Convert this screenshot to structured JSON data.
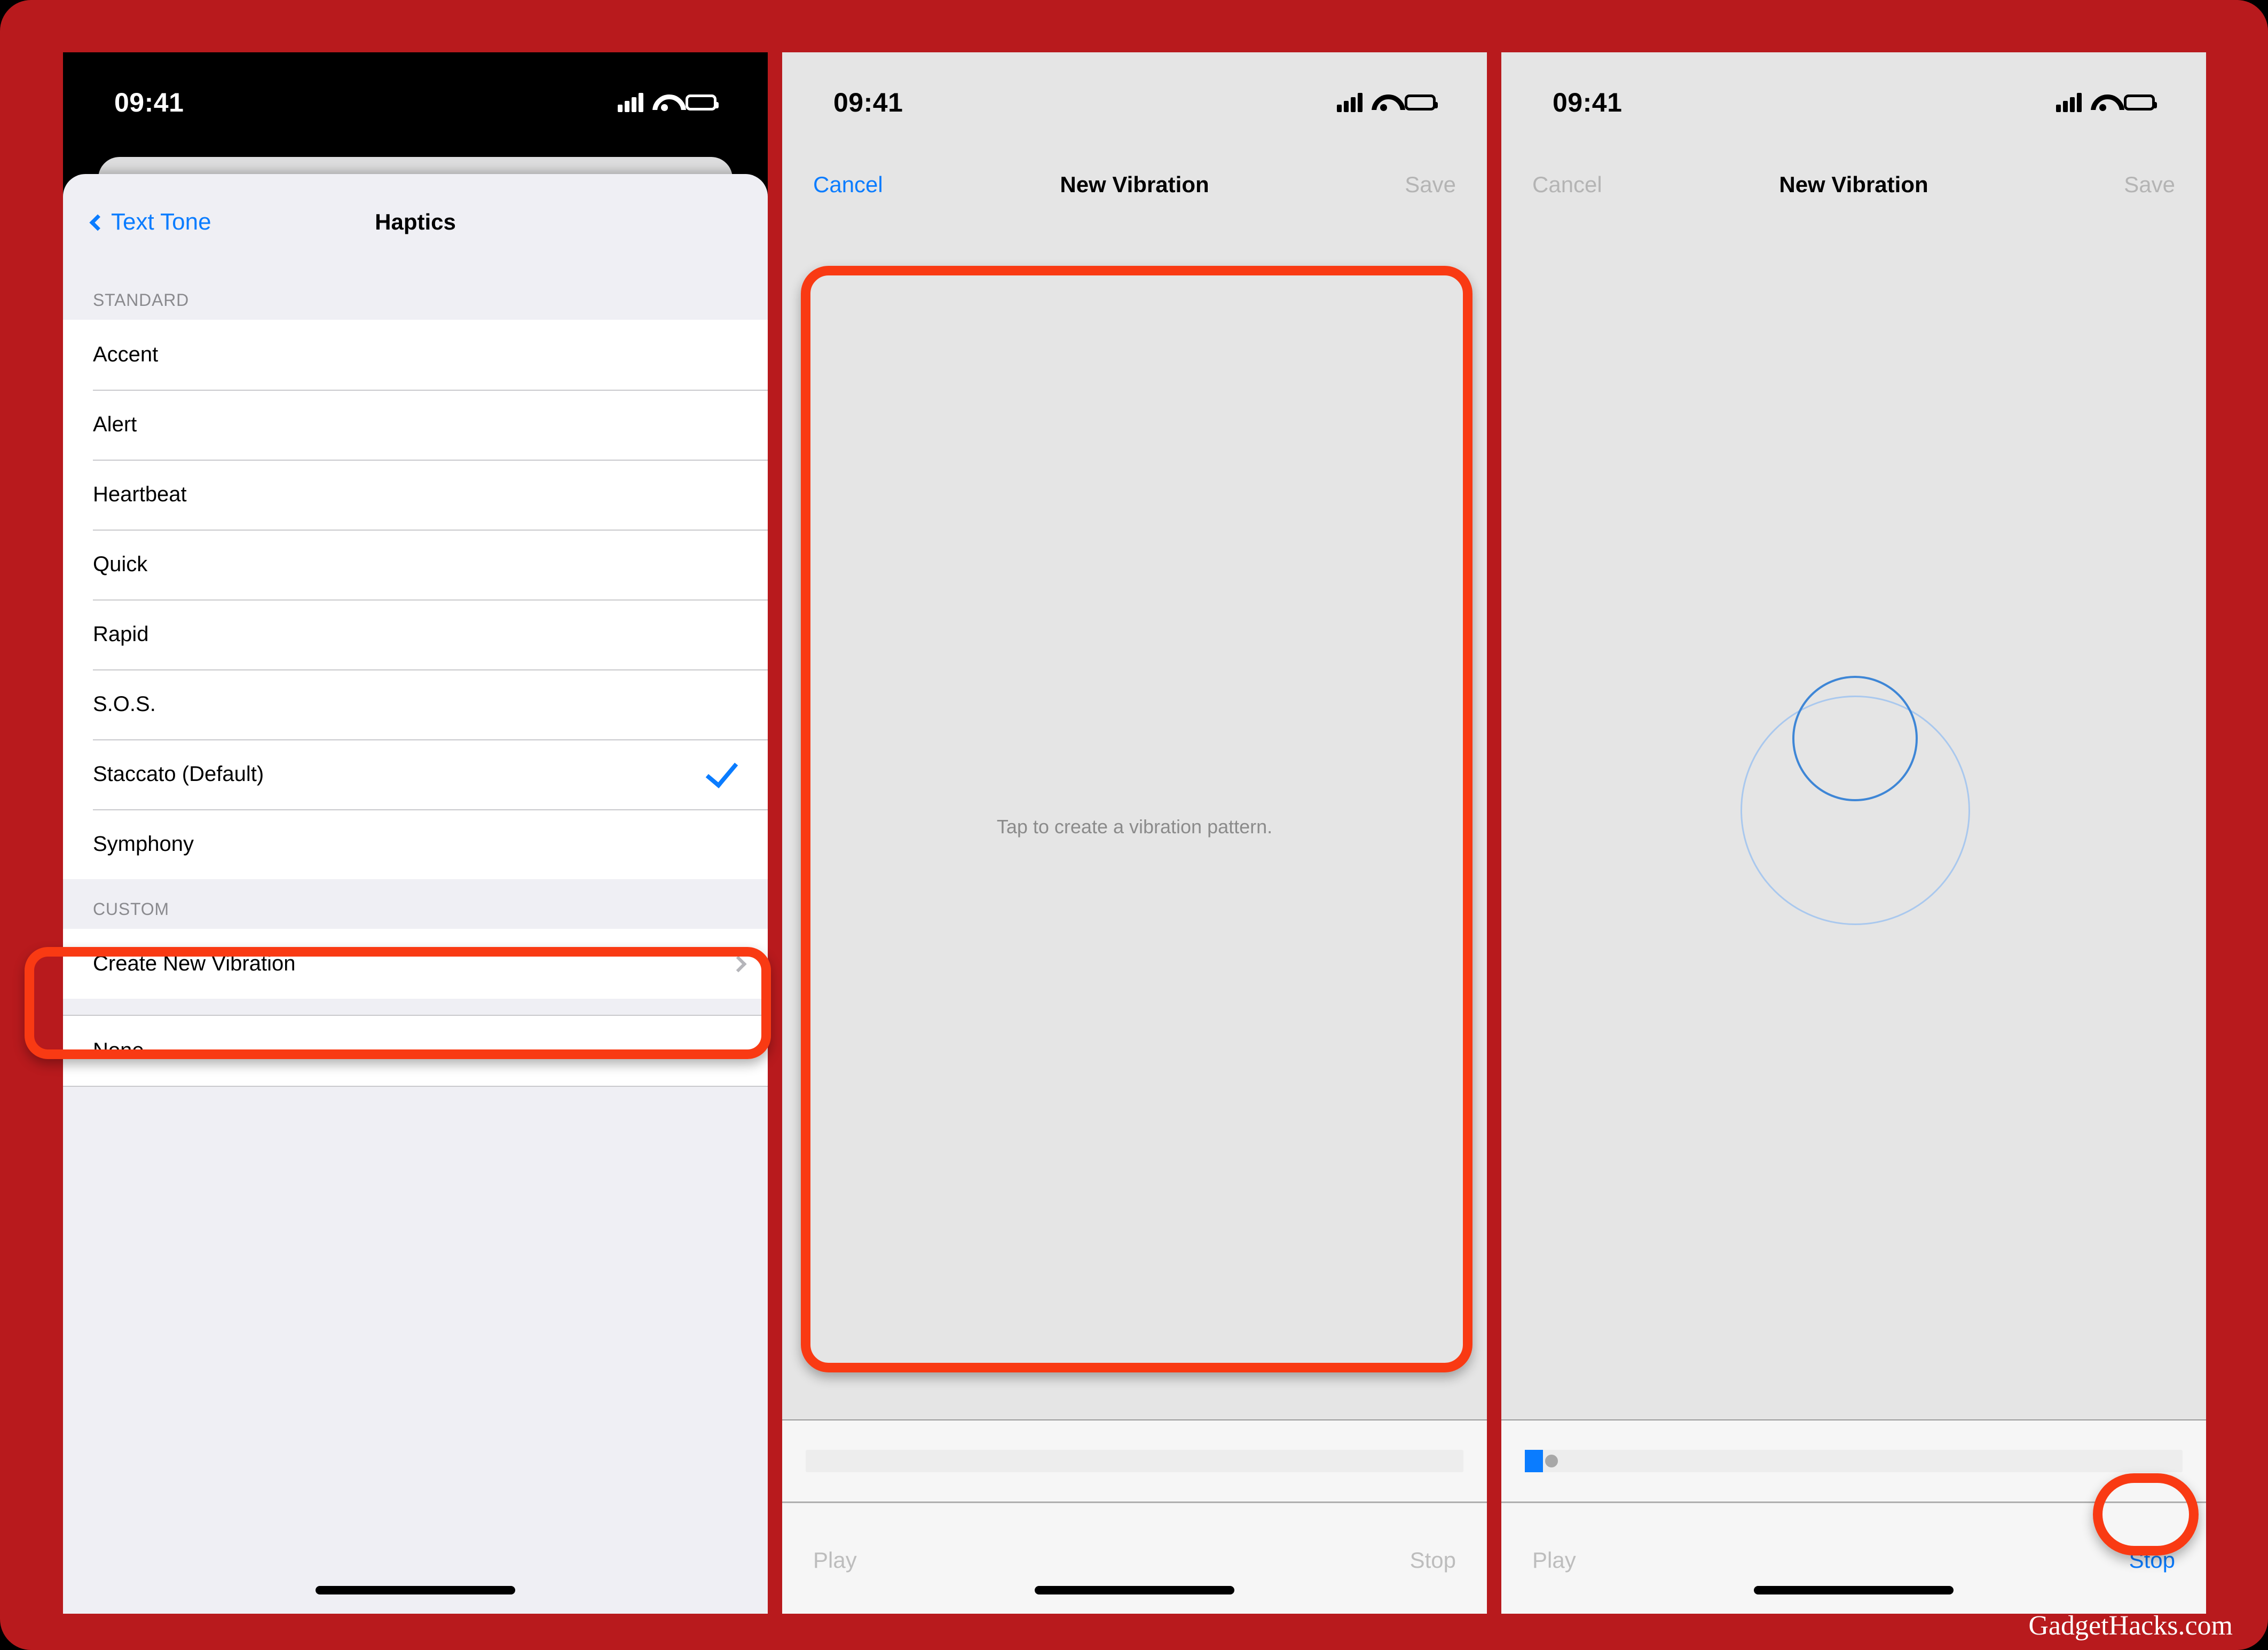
{
  "theme": {
    "background_red": "#B81A1D",
    "annotation_orange": "#F93A13",
    "ios_blue": "#0A7CFF",
    "disabled_gray": "#B4B4B4",
    "sheet_gray": "#EFEFF4",
    "tap_area_gray": "#E5E5E5"
  },
  "watermark": "GadgetHacks.com",
  "panel1": {
    "status_bar": {
      "time": "09:41",
      "cellular": "signal-bars-icon",
      "wifi": "wifi-icon",
      "battery": "battery-icon"
    },
    "nav": {
      "back_label": "Text Tone",
      "title": "Haptics"
    },
    "sections": [
      {
        "header": "STANDARD",
        "rows": [
          {
            "label": "Accent",
            "checked": false,
            "chevron": false
          },
          {
            "label": "Alert",
            "checked": false,
            "chevron": false
          },
          {
            "label": "Heartbeat",
            "checked": false,
            "chevron": false
          },
          {
            "label": "Quick",
            "checked": false,
            "chevron": false
          },
          {
            "label": "Rapid",
            "checked": false,
            "chevron": false
          },
          {
            "label": "S.O.S.",
            "checked": false,
            "chevron": false
          },
          {
            "label": "Staccato (Default)",
            "checked": true,
            "chevron": false
          },
          {
            "label": "Symphony",
            "checked": false,
            "chevron": false
          }
        ]
      },
      {
        "header": "CUSTOM",
        "rows": [
          {
            "label": "Create New Vibration",
            "checked": false,
            "chevron": true
          }
        ]
      },
      {
        "header": "",
        "rows": [
          {
            "label": "None",
            "checked": false,
            "chevron": false
          }
        ]
      }
    ]
  },
  "panel2": {
    "status_bar": {
      "time": "09:41"
    },
    "nav": {
      "cancel": "Cancel",
      "cancel_enabled": true,
      "title": "New Vibration",
      "save": "Save",
      "save_enabled": false
    },
    "tap_area": {
      "hint": "Tap to create a vibration pattern.",
      "ripples": 0
    },
    "progress": {
      "percent": 0
    },
    "transport": {
      "play": "Play",
      "play_enabled": false,
      "stop": "Stop",
      "stop_enabled": false
    }
  },
  "panel3": {
    "status_bar": {
      "time": "09:41"
    },
    "nav": {
      "cancel": "Cancel",
      "cancel_enabled": false,
      "title": "New Vibration",
      "save": "Save",
      "save_enabled": false
    },
    "tap_area": {
      "hint": "",
      "ripples": 2
    },
    "progress": {
      "percent": 3
    },
    "transport": {
      "play": "Play",
      "play_enabled": false,
      "stop": "Stop",
      "stop_enabled": true
    }
  },
  "annotations": [
    {
      "id": "custom-section",
      "target": "CUSTOM / Create New Vibration",
      "shape": "rounded-rect"
    },
    {
      "id": "tap-canvas",
      "target": "vibration tap canvas",
      "shape": "rounded-rect"
    },
    {
      "id": "stop-button",
      "target": "Stop",
      "shape": "oval"
    }
  ]
}
